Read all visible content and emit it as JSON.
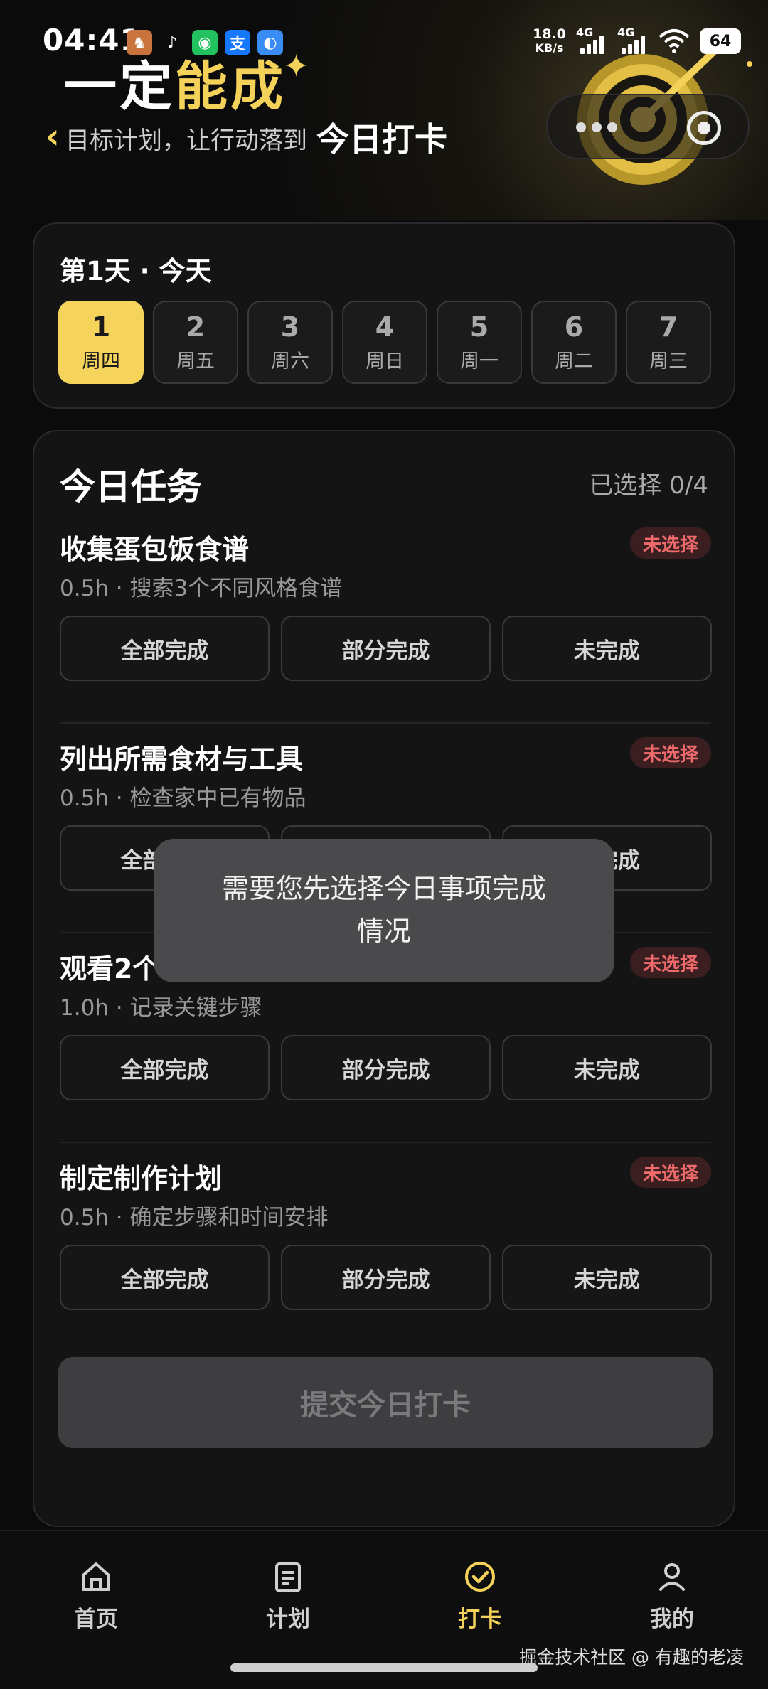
{
  "status_bar": {
    "time": "04:41",
    "net_speed_value": "18.0",
    "net_speed_unit": "KB/s",
    "signal1": "4G",
    "signal2": "4G",
    "battery": "64"
  },
  "header": {
    "slogan_part1": "一定",
    "slogan_part2": "能成",
    "subtitle": "目标计划，让行动落到",
    "title": "今日打卡"
  },
  "day_card": {
    "title": "第1天 · 今天",
    "days": [
      {
        "num": "1",
        "weekday": "周四",
        "active": true
      },
      {
        "num": "2",
        "weekday": "周五"
      },
      {
        "num": "3",
        "weekday": "周六"
      },
      {
        "num": "4",
        "weekday": "周日"
      },
      {
        "num": "5",
        "weekday": "周一"
      },
      {
        "num": "6",
        "weekday": "周二"
      },
      {
        "num": "7",
        "weekday": "周三"
      }
    ]
  },
  "tasks_card": {
    "title": "今日任务",
    "selected": "已选择 0/4",
    "status_badge": "未选择",
    "options": [
      "全部完成",
      "部分完成",
      "未完成"
    ],
    "tasks": [
      {
        "name": "收集蛋包饭食谱",
        "desc": "0.5h · 搜索3个不同风格食谱"
      },
      {
        "name": "列出所需食材与工具",
        "desc": "0.5h · 检查家中已有物品"
      },
      {
        "name": "观看2个",
        "desc": "1.0h · 记录关键步骤"
      },
      {
        "name": "制定制作计划",
        "desc": "0.5h · 确定步骤和时间安排"
      }
    ],
    "submit": "提交今日打卡"
  },
  "toast": {
    "line1": "需要您先选择今日事项完成",
    "line2": "情况"
  },
  "tabbar": {
    "items": [
      {
        "label": "首页",
        "icon": "home-icon"
      },
      {
        "label": "计划",
        "icon": "clipboard-icon"
      },
      {
        "label": "打卡",
        "icon": "check-circle-icon",
        "active": true
      },
      {
        "label": "我的",
        "icon": "user-icon"
      }
    ]
  },
  "watermark": "掘金技术社区 @ 有趣的老凌",
  "colors": {
    "accent": "#f4d25a",
    "badge_text": "#ef6b6b",
    "background": "#0b0b0c"
  }
}
